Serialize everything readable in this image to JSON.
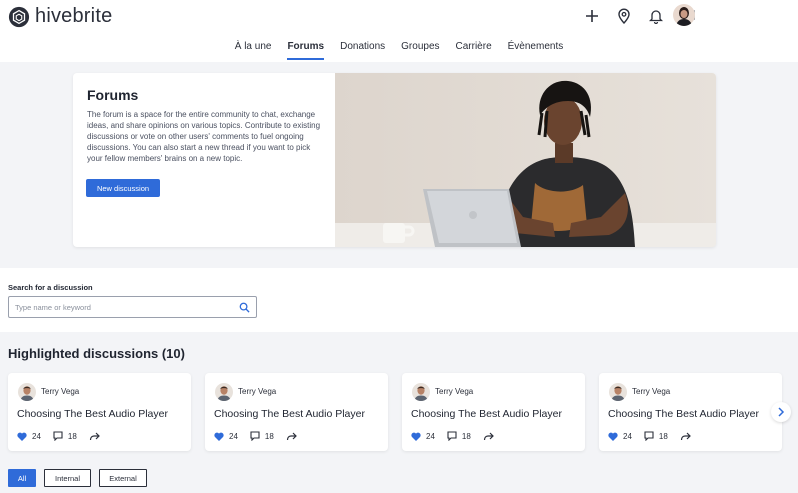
{
  "brand": {
    "name": "hivebrite",
    "logo_icon": "hexagon-logo-icon"
  },
  "header_icons": [
    "plus-icon",
    "location-pin-icon",
    "bell-icon",
    "chat-icon"
  ],
  "nav": {
    "items": [
      {
        "label": "À la une",
        "active": false
      },
      {
        "label": "Forums",
        "active": true
      },
      {
        "label": "Donations",
        "active": false
      },
      {
        "label": "Groupes",
        "active": false
      },
      {
        "label": "Carrière",
        "active": false
      },
      {
        "label": "Évènements",
        "active": false
      }
    ]
  },
  "hero": {
    "title": "Forums",
    "description": "The forum is a space for the entire community to chat, exchange ideas, and share opinions on various topics. Contribute to existing discussions or vote on other users' comments to fuel ongoing discussions. You can also start a new thread if you want to pick your fellow members' brains on a new topic.",
    "button_label": "New discussion"
  },
  "search": {
    "label": "Search for a discussion",
    "placeholder": "Type name or keyword",
    "value": ""
  },
  "highlighted": {
    "title": "Highlighted discussions (10)",
    "cards": [
      {
        "author": "Terry Vega",
        "title": "Choosing The Best Audio Player",
        "likes": "24",
        "comments": "18"
      },
      {
        "author": "Terry Vega",
        "title": "Choosing The Best Audio Player",
        "likes": "24",
        "comments": "18"
      },
      {
        "author": "Terry Vega",
        "title": "Choosing The Best Audio Player",
        "likes": "24",
        "comments": "18"
      },
      {
        "author": "Terry Vega",
        "title": "Choosing The Best Audio Player",
        "likes": "24",
        "comments": "18"
      }
    ]
  },
  "filters": [
    {
      "label": "All",
      "active": true
    },
    {
      "label": "Internal",
      "active": false
    },
    {
      "label": "External",
      "active": false
    }
  ],
  "colors": {
    "accent": "#2f6bd9",
    "text": "#1f2430",
    "background": "#f3f4f7"
  }
}
